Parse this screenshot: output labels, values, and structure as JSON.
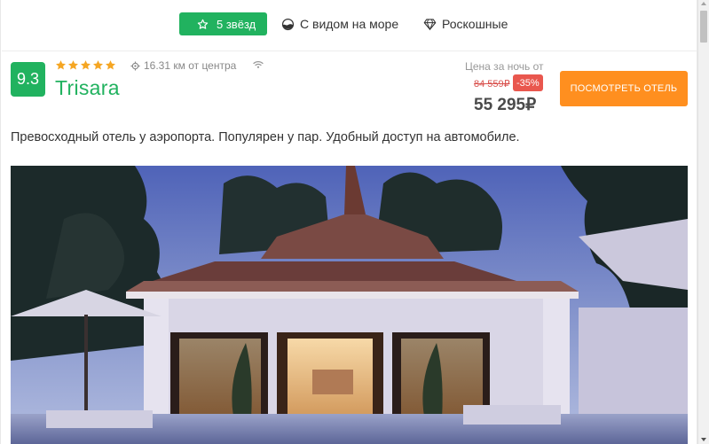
{
  "filters": {
    "stars_label": "5 звёзд",
    "sea_view_label": "С видом на море",
    "luxury_label": "Роскошные"
  },
  "hotel": {
    "rating": "9.3",
    "stars": 5,
    "distance": "16.31 км от центра",
    "name": "Trisara",
    "price_caption": "Цена за ночь от",
    "old_price": "84 559₽",
    "discount": "-35%",
    "price": "55 295₽",
    "view_button": "ПОСМОТРЕТЬ ОТЕЛЬ",
    "description": "Превосходный отель у аэропорта. Популярен у пар. Удобный доступ на автомобиле."
  },
  "colors": {
    "accent_green": "#21b25f",
    "button_orange": "#ff8f1f",
    "discount_red": "#e9574e",
    "star_orange": "#f5a623"
  },
  "icons": {
    "stars_filter": "star-outline-icon",
    "sea_view": "sea-view-icon",
    "luxury": "diamond-icon",
    "distance": "location-pin-icon",
    "wifi": "wifi-icon"
  }
}
